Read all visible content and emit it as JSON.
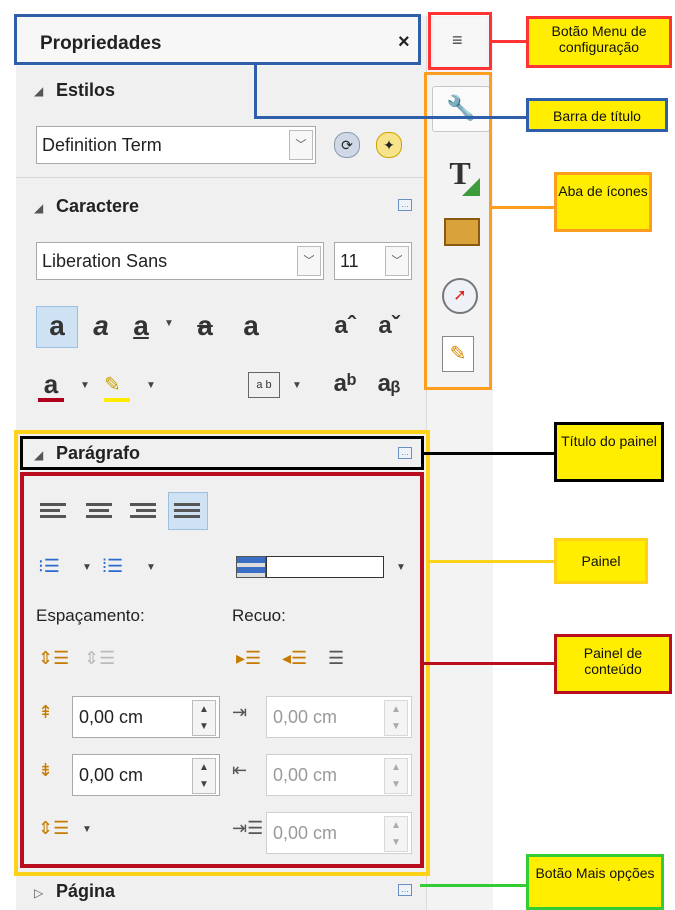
{
  "panel": {
    "title": "Propriedades",
    "close": "×",
    "menu_icon": "≡"
  },
  "styles": {
    "header": "Estilos",
    "value": "Definition Term"
  },
  "character": {
    "header": "Caractere",
    "font": "Liberation Sans",
    "size": "11"
  },
  "paragraph": {
    "header": "Parágrafo",
    "spacing_label": "Espaçamento:",
    "indent_label": "Recuo:",
    "above": "0,00 cm",
    "below": "0,00 cm",
    "indent_before": "0,00 cm",
    "indent_after": "0,00 cm",
    "first_line": "0,00 cm"
  },
  "page_section": {
    "header": "Página"
  },
  "icons": {
    "tabs": [
      "wrench-icon",
      "styles-t-icon",
      "gallery-icon",
      "navigator-compass-icon",
      "manage-changes-icon"
    ]
  },
  "callouts": {
    "menu_button": "Botão Menu de configuração",
    "title_bar": "Barra de título",
    "tab_icons": "Aba de ícones",
    "panel_title": "Título do painel",
    "panel": "Painel",
    "content_panel": "Painel de conteúdo",
    "more_options": "Botão Mais opções"
  },
  "colors": {
    "red": "#ff3333",
    "blue": "#2e5fa8",
    "orange": "#ff9d1f",
    "yellow": "#ffee00",
    "gold": "#ffd21a",
    "darkred": "#b80e1d",
    "green": "#33cc33",
    "black": "#000000"
  }
}
